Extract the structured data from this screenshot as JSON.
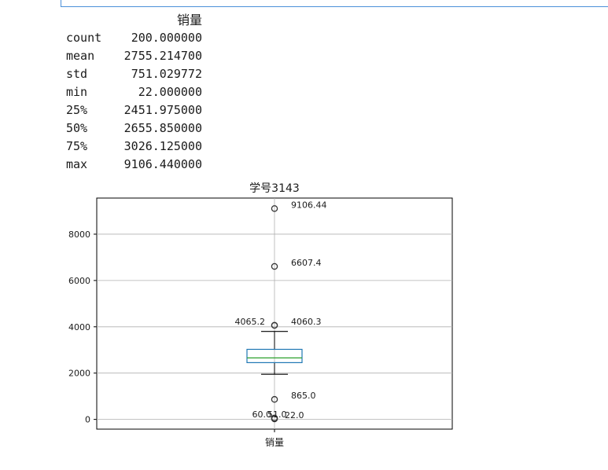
{
  "describe": {
    "column": "销量",
    "rows": [
      {
        "label": "count",
        "value": "200.000000"
      },
      {
        "label": "mean",
        "value": "2755.214700"
      },
      {
        "label": "std",
        "value": "751.029772"
      },
      {
        "label": "min",
        "value": "22.000000"
      },
      {
        "label": "25%",
        "value": "2451.975000"
      },
      {
        "label": "50%",
        "value": "2655.850000"
      },
      {
        "label": "75%",
        "value": "3026.125000"
      },
      {
        "label": "max",
        "value": "9106.440000"
      }
    ]
  },
  "chart_data": {
    "type": "box",
    "title": "学号3143",
    "xlabel": "",
    "ylabel": "",
    "categories": [
      "销量"
    ],
    "ylim": [
      -420,
      9560
    ],
    "yticks": [
      0,
      2000,
      4000,
      6000,
      8000
    ],
    "grid": true,
    "box": {
      "q1": 2451.975,
      "median": 2655.85,
      "q3": 3026.125,
      "whisker_low": 1950,
      "whisker_high": 3800
    },
    "outliers": [
      9106.44,
      6607.4,
      4065.2,
      4060.3,
      865.0,
      60.0,
      51.0,
      22.0
    ],
    "annotations": [
      {
        "text": "9106.44",
        "y": 9106.44,
        "side": "right"
      },
      {
        "text": "6607.4",
        "y": 6607.4,
        "side": "right"
      },
      {
        "text": "4065.2",
        "y": 4065.2,
        "side": "left"
      },
      {
        "text": "4060.3",
        "y": 4060.3,
        "side": "right"
      },
      {
        "text": "865.0",
        "y": 865.0,
        "side": "right"
      },
      {
        "text": "60.0",
        "y": 60.0,
        "side": "left"
      },
      {
        "text": "51.0",
        "y": 51.0,
        "side": "center"
      },
      {
        "text": "22.0",
        "y": 22.0,
        "side": "right"
      }
    ],
    "colors": {
      "box": "#1f77b4",
      "median": "#2ca02c",
      "whisker": "#000000",
      "grid": "#b0b0b0"
    }
  }
}
